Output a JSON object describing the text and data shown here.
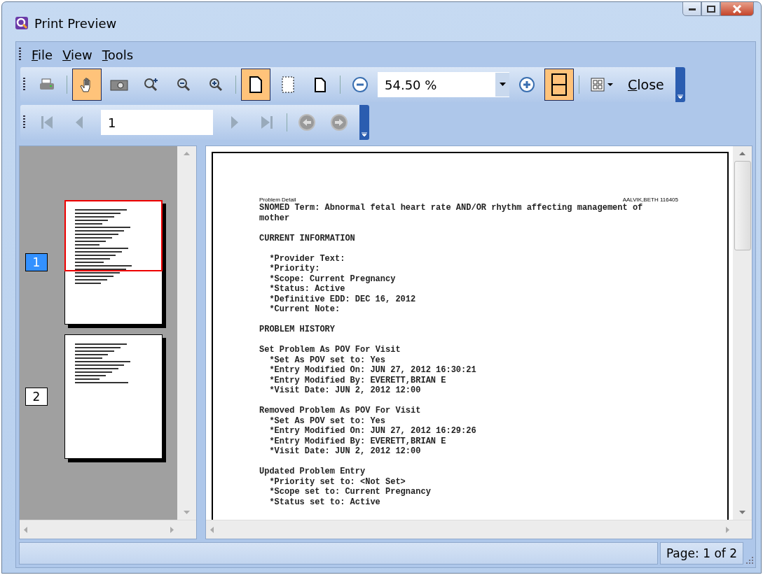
{
  "window": {
    "title": "Print Preview"
  },
  "menu": [
    {
      "label": "File"
    },
    {
      "label": "View"
    },
    {
      "label": "Tools"
    }
  ],
  "toolbar": [
    {
      "kind": "print",
      "selected": false
    },
    {
      "kind": "sep"
    },
    {
      "kind": "hand",
      "selected": true
    },
    {
      "kind": "snapshot",
      "selected": false
    },
    {
      "kind": "zoom-region",
      "selected": false
    },
    {
      "kind": "zoom-out",
      "selected": false
    },
    {
      "kind": "zoom-in",
      "selected": false
    },
    {
      "kind": "sep"
    },
    {
      "kind": "page",
      "selected": true
    },
    {
      "kind": "margins",
      "selected": false
    },
    {
      "kind": "page-small",
      "selected": false
    },
    {
      "kind": "sep"
    },
    {
      "kind": "minus",
      "selected": false
    },
    {
      "kind": "zoom-field",
      "value": "54.50 %"
    },
    {
      "kind": "plus",
      "selected": false
    },
    {
      "kind": "two-page",
      "selected": true
    },
    {
      "kind": "sep"
    },
    {
      "kind": "grid",
      "selected": false
    },
    {
      "kind": "link",
      "label": "Close"
    }
  ],
  "nav": {
    "page_value": "1"
  },
  "thumbnails": [
    {
      "label": "1",
      "selected": true
    },
    {
      "label": "2",
      "selected": false
    }
  ],
  "document": {
    "header_left": "Problem Detail",
    "header_right": "AALVIK,BETH 116405",
    "blocks": [
      {
        "text": "SNOMED Term: Abnormal fetal heart rate AND/OR rhythm affecting management of mother"
      },
      {
        "text": "CURRENT INFORMATION"
      },
      {
        "items": [
          "*Provider Text:",
          "*Priority:",
          "*Scope: Current Pregnancy",
          "*Status: Active",
          "*Definitive EDD: DEC 16, 2012",
          "*Current Note:"
        ]
      },
      {
        "text": "PROBLEM HISTORY"
      },
      {
        "text": "Set Problem As POV For Visit",
        "items": [
          "*Set As POV set to: Yes",
          "*Entry Modified On: JUN 27, 2012 16:30:21",
          "*Entry Modified By: EVERETT,BRIAN E",
          "*Visit Date: JUN 2, 2012 12:00"
        ]
      },
      {
        "text": "Removed Problem As POV For Visit",
        "items": [
          "*Set As POV set to: Yes",
          "*Entry Modified On: JUN 27, 2012 16:29:26",
          "*Entry Modified By: EVERETT,BRIAN E",
          "*Visit Date: JUN 2, 2012 12:00"
        ]
      },
      {
        "text": "Updated Problem Entry",
        "items": [
          "*Priority set to: <Not Set>",
          "*Scope set to: Current Pregnancy",
          "*Status set to: Active"
        ]
      }
    ]
  },
  "status_bar": {
    "page": "Page: 1 of 2"
  }
}
